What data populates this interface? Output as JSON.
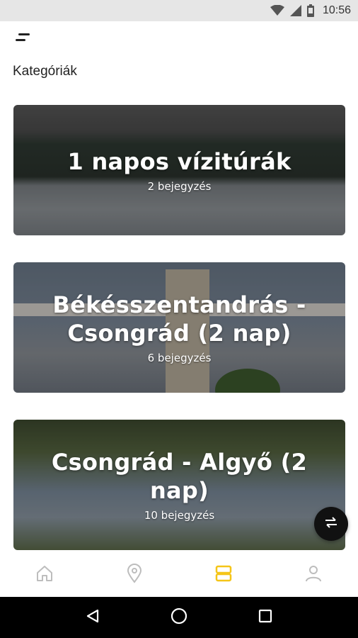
{
  "status_bar": {
    "time": "10:56",
    "icons": [
      "wifi-icon",
      "signal-icon",
      "battery-icon"
    ]
  },
  "header": {
    "menu_icon": "menu-icon"
  },
  "section_title": "Kategóriák",
  "categories": [
    {
      "title": "1 napos vízitúrák",
      "count": "2 bejegyzés"
    },
    {
      "title": "Békésszentandrás - Csongrád (2 nap)",
      "count": "6 bejegyzés"
    },
    {
      "title": "Csongrád - Algyő (2 nap)",
      "count": "10 bejegyzés"
    }
  ],
  "fab": {
    "icon": "swap-icon"
  },
  "bottom_nav": [
    {
      "name": "home",
      "icon": "home-icon",
      "active": false
    },
    {
      "name": "map",
      "icon": "location-pin-icon",
      "active": false
    },
    {
      "name": "categories",
      "icon": "categories-icon",
      "active": true
    },
    {
      "name": "profile",
      "icon": "user-icon",
      "active": false
    }
  ],
  "colors": {
    "accent": "#f5c518",
    "inactive_icon": "#bdbdbd"
  },
  "system_nav": [
    "back-icon",
    "home-circle-icon",
    "recents-icon"
  ]
}
